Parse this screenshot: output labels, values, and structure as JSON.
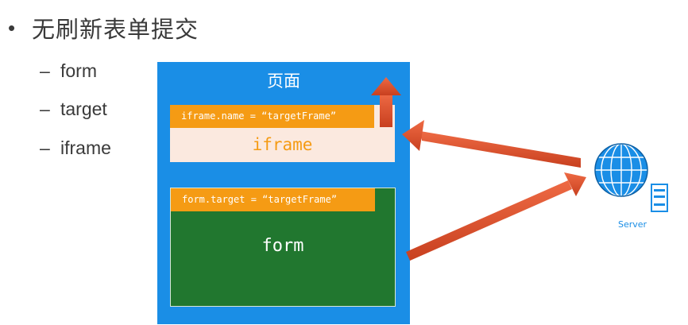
{
  "slide": {
    "heading": "无刷新表单提交",
    "bullets": [
      "form",
      "target",
      "iframe"
    ]
  },
  "diagram": {
    "page_title": "页面",
    "iframe_code": "iframe.name = “targetFrame”",
    "iframe_label": "iframe",
    "form_code": "form.target = “targetFrame”",
    "form_label": "form",
    "server_label": "Server",
    "server_icon": "globe-server-icon"
  },
  "colors": {
    "page_blue": "#1a8ee6",
    "code_orange": "#f59b14",
    "iframe_bg": "#fbe9df",
    "form_green": "#21772f",
    "arrow_red": "#e0532e"
  }
}
